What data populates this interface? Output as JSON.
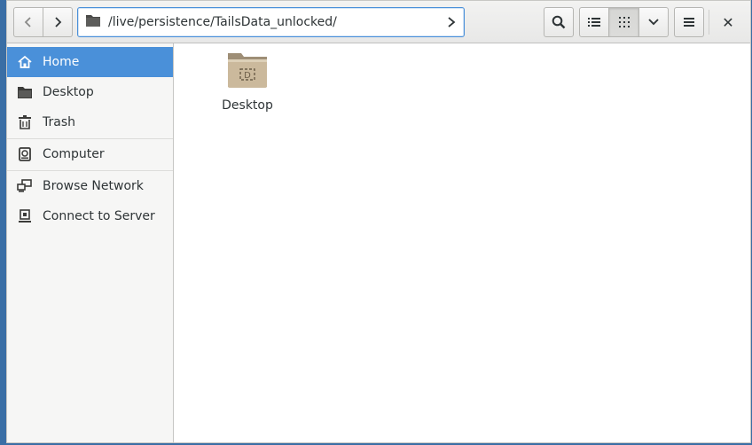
{
  "toolbar": {
    "back_icon": "chevron-left-icon",
    "forward_icon": "chevron-right-icon",
    "path": "/live/persistence/TailsData_unlocked/",
    "search_icon": "search-icon",
    "list_view_icon": "list-view-icon",
    "grid_view_icon": "grid-view-icon",
    "view_options_icon": "chevron-down-icon",
    "menu_icon": "hamburger-menu-icon",
    "close_label": "✕"
  },
  "sidebar": {
    "items": [
      {
        "label": "Home",
        "icon": "home-icon",
        "selected": true
      },
      {
        "label": "Desktop",
        "icon": "folder-icon"
      },
      {
        "label": "Trash",
        "icon": "trash-icon"
      },
      {
        "label": "Computer",
        "icon": "drive-icon"
      },
      {
        "label": "Browse Network",
        "icon": "network-icon"
      },
      {
        "label": "Connect to Server",
        "icon": "server-icon"
      }
    ]
  },
  "files": [
    {
      "name": "Desktop",
      "icon": "desktop-folder-icon"
    }
  ],
  "colors": {
    "accent": "#4a90d9",
    "folder": "#c6b49a"
  }
}
